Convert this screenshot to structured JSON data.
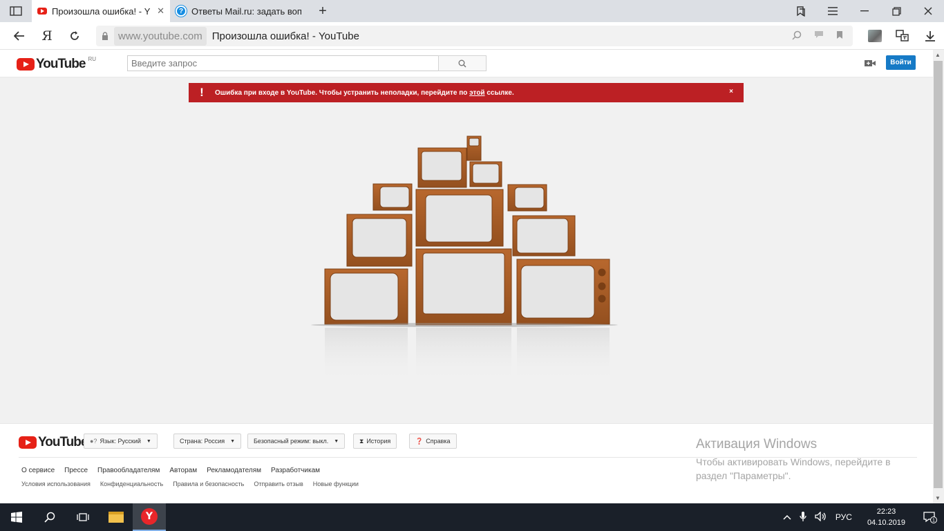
{
  "browser": {
    "tabs": [
      {
        "title": "Произошла ошибка! - Y",
        "close": "✕"
      },
      {
        "title": "Ответы Mail.ru: задать вопр",
        "favicon": "?"
      }
    ],
    "newtab_label": "+",
    "yandex_button": "Я",
    "address": {
      "domain": "www.youtube.com",
      "page_title": "Произошла ошибка! - YouTube"
    }
  },
  "youtube": {
    "logo_text": "YouTube",
    "region": "RU",
    "search_placeholder": "Введите запрос",
    "login_label": "Войти",
    "error": {
      "text_before": "Ошибка при входе в YouTube. Чтобы устранить неполадки, перейдите по ",
      "link": "этой",
      "text_after": " ссылке.",
      "close": "×"
    },
    "footer": {
      "logo_text": "YouTube",
      "language": "Язык: Русский",
      "country": "Страна: Россия",
      "safe_mode": "Безопасный режим: выкл.",
      "history": "История",
      "help": "Справка",
      "links_primary": [
        "О сервисе",
        "Прессе",
        "Правообладателям",
        "Авторам",
        "Рекламодателям",
        "Разработчикам"
      ],
      "links_secondary": [
        "Условия использования",
        "Конфиденциальность",
        "Правила и безопасность",
        "Отправить отзыв",
        "Новые функции"
      ]
    }
  },
  "windows_activation": {
    "title": "Активация Windows",
    "text": "Чтобы активировать Windows, перейдите в раздел \"Параметры\"."
  },
  "taskbar": {
    "lang": "РУС",
    "time": "22:23",
    "date": "04.10.2019",
    "notification_count": "1",
    "yandex_letter": "Y"
  },
  "colors": {
    "accent": "#167ac6",
    "error_red": "#bc2024",
    "youtube_red": "#e62117"
  }
}
